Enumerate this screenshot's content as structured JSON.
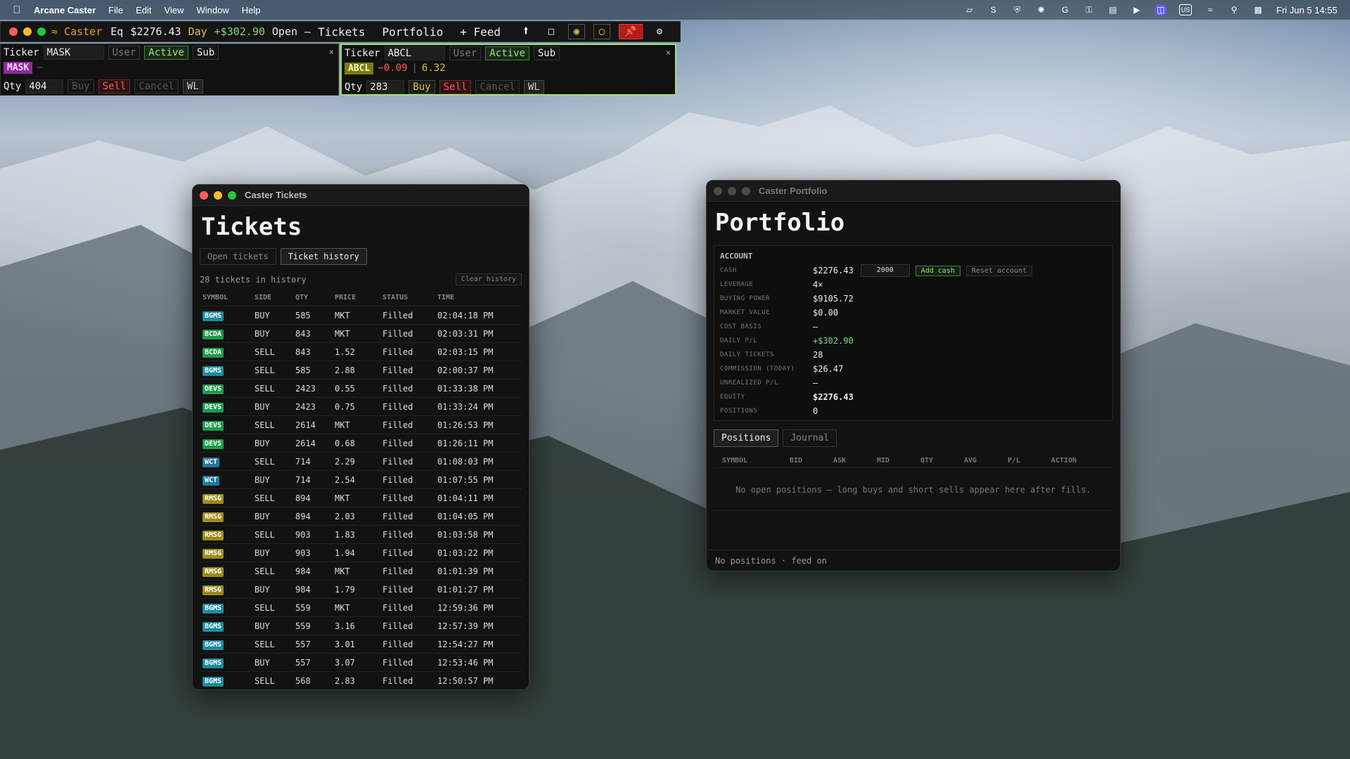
{
  "menubar": {
    "app_name": "Arcane Caster",
    "menus": [
      "File",
      "Edit",
      "View",
      "Window",
      "Help"
    ],
    "tray_input_source": "US",
    "clock": "Fri Jun 5  14:55"
  },
  "caster_bar": {
    "brand": "Caster",
    "eq_label": "Eq",
    "eq_value": "$2276.43",
    "day_label": "Day",
    "day_value": "+$302.90",
    "open_label": "Open",
    "open_value": "—",
    "nav_tickets": "Tickets",
    "nav_portfolio": "Portfolio",
    "nav_feed": "+ Feed"
  },
  "ticket_left": {
    "ticker_label": "Ticker",
    "ticker_value": "MASK",
    "btn_user": "User",
    "btn_active": "Active",
    "btn_sub": "Sub",
    "symbol": "MASK",
    "quote": "—",
    "qty_label": "Qty",
    "qty_value": "404",
    "btn_buy": "Buy",
    "btn_sell": "Sell",
    "btn_cancel": "Cancel",
    "btn_wl": "WL",
    "close": "×"
  },
  "ticket_right": {
    "ticker_label": "Ticker",
    "ticker_value": "ABCL",
    "btn_user": "User",
    "btn_active": "Active",
    "btn_sub": "Sub",
    "symbol": "ABCL",
    "change": "−0.09",
    "sep": "|",
    "price": "6.32",
    "qty_label": "Qty",
    "qty_value": "283",
    "btn_buy": "Buy",
    "btn_sell": "Sell",
    "btn_cancel": "Cancel",
    "btn_wl": "WL",
    "close": "×"
  },
  "tickets_window": {
    "title": "Caster Tickets",
    "heading": "Tickets",
    "tab_open": "Open tickets",
    "tab_history": "Ticket history",
    "count_text": "28 tickets in history",
    "clear_btn": "Clear history",
    "columns": [
      "SYMBOL",
      "SIDE",
      "QTY",
      "PRICE",
      "STATUS",
      "TIME"
    ],
    "rows": [
      {
        "symbol": "BGMS",
        "color": "#1f8a9a",
        "side": "BUY",
        "qty": "585",
        "price": "MKT",
        "status": "Filled",
        "time": "02:04:18 PM"
      },
      {
        "symbol": "BCDA",
        "color": "#1f9a4a",
        "side": "BUY",
        "qty": "843",
        "price": "MKT",
        "status": "Filled",
        "time": "02:03:31 PM"
      },
      {
        "symbol": "BCDA",
        "color": "#1f9a4a",
        "side": "SELL",
        "qty": "843",
        "price": "1.52",
        "status": "Filled",
        "time": "02:03:15 PM"
      },
      {
        "symbol": "BGMS",
        "color": "#1f8a9a",
        "side": "SELL",
        "qty": "585",
        "price": "2.88",
        "status": "Filled",
        "time": "02:00:37 PM"
      },
      {
        "symbol": "DEVS",
        "color": "#1f9a4a",
        "side": "SELL",
        "qty": "2423",
        "price": "0.55",
        "status": "Filled",
        "time": "01:33:38 PM"
      },
      {
        "symbol": "DEVS",
        "color": "#1f9a4a",
        "side": "BUY",
        "qty": "2423",
        "price": "0.75",
        "status": "Filled",
        "time": "01:33:24 PM"
      },
      {
        "symbol": "DEVS",
        "color": "#1f9a4a",
        "side": "SELL",
        "qty": "2614",
        "price": "MKT",
        "status": "Filled",
        "time": "01:26:53 PM"
      },
      {
        "symbol": "DEVS",
        "color": "#1f9a4a",
        "side": "BUY",
        "qty": "2614",
        "price": "0.68",
        "status": "Filled",
        "time": "01:26:11 PM"
      },
      {
        "symbol": "WCT",
        "color": "#1f7a9a",
        "side": "SELL",
        "qty": "714",
        "price": "2.29",
        "status": "Filled",
        "time": "01:08:03 PM"
      },
      {
        "symbol": "WCT",
        "color": "#1f7a9a",
        "side": "BUY",
        "qty": "714",
        "price": "2.54",
        "status": "Filled",
        "time": "01:07:55 PM"
      },
      {
        "symbol": "RMSG",
        "color": "#9a8a1f",
        "side": "SELL",
        "qty": "894",
        "price": "MKT",
        "status": "Filled",
        "time": "01:04:11 PM"
      },
      {
        "symbol": "RMSG",
        "color": "#9a8a1f",
        "side": "BUY",
        "qty": "894",
        "price": "2.03",
        "status": "Filled",
        "time": "01:04:05 PM"
      },
      {
        "symbol": "RMSG",
        "color": "#9a8a1f",
        "side": "SELL",
        "qty": "903",
        "price": "1.83",
        "status": "Filled",
        "time": "01:03:58 PM"
      },
      {
        "symbol": "RMSG",
        "color": "#9a8a1f",
        "side": "BUY",
        "qty": "903",
        "price": "1.94",
        "status": "Filled",
        "time": "01:03:22 PM"
      },
      {
        "symbol": "RMSG",
        "color": "#9a8a1f",
        "side": "SELL",
        "qty": "984",
        "price": "MKT",
        "status": "Filled",
        "time": "01:01:39 PM"
      },
      {
        "symbol": "RMSG",
        "color": "#9a8a1f",
        "side": "BUY",
        "qty": "984",
        "price": "1.79",
        "status": "Filled",
        "time": "01:01:27 PM"
      },
      {
        "symbol": "BGMS",
        "color": "#1f8a9a",
        "side": "SELL",
        "qty": "559",
        "price": "MKT",
        "status": "Filled",
        "time": "12:59:36 PM"
      },
      {
        "symbol": "BGMS",
        "color": "#1f8a9a",
        "side": "BUY",
        "qty": "559",
        "price": "3.16",
        "status": "Filled",
        "time": "12:57:39 PM"
      },
      {
        "symbol": "BGMS",
        "color": "#1f8a9a",
        "side": "SELL",
        "qty": "557",
        "price": "3.01",
        "status": "Filled",
        "time": "12:54:27 PM"
      },
      {
        "symbol": "BGMS",
        "color": "#1f8a9a",
        "side": "BUY",
        "qty": "557",
        "price": "3.07",
        "status": "Filled",
        "time": "12:53:46 PM"
      },
      {
        "symbol": "BGMS",
        "color": "#1f8a9a",
        "side": "SELL",
        "qty": "568",
        "price": "2.83",
        "status": "Filled",
        "time": "12:50:57 PM"
      }
    ]
  },
  "portfolio_window": {
    "title": "Caster Portfolio",
    "heading": "Portfolio",
    "account_heading": "ACCOUNT",
    "cash_label": "CASH",
    "cash_value": "$2276.43",
    "cash_input": "2000",
    "add_cash_btn": "Add cash",
    "reset_btn": "Reset account",
    "leverage_label": "LEVERAGE",
    "leverage_value": "4×",
    "buying_power_label": "BUYING POWER",
    "buying_power_value": "$9105.72",
    "market_value_label": "MARKET VALUE",
    "market_value_value": "$0.00",
    "cost_basis_label": "COST BASIS",
    "cost_basis_value": "—",
    "daily_pl_label": "DAILY P/L",
    "daily_pl_value": "+$302.90",
    "daily_tickets_label": "DAILY TICKETS",
    "daily_tickets_value": "28",
    "commission_label": "COMMISSION (TODAY)",
    "commission_value": "$26.47",
    "unrealized_label": "UNREALIZED P/L",
    "unrealized_value": "—",
    "equity_label": "EQUITY",
    "equity_value": "$2276.43",
    "positions_label": "POSITIONS",
    "positions_value": "0",
    "tab_positions": "Positions",
    "tab_journal": "Journal",
    "columns": [
      "SYMBOL",
      "BID",
      "ASK",
      "MID",
      "QTY",
      "AVG",
      "P/L",
      "ACTION"
    ],
    "empty_message": "No open positions — long buys and short sells appear here after fills.",
    "footer": "No positions · feed on"
  },
  "colors": {
    "accent_green": "#9fe07a",
    "sell_red": "#ff5a5a",
    "buy_yellow": "#e0c040",
    "brand_orange": "#f0a020"
  }
}
